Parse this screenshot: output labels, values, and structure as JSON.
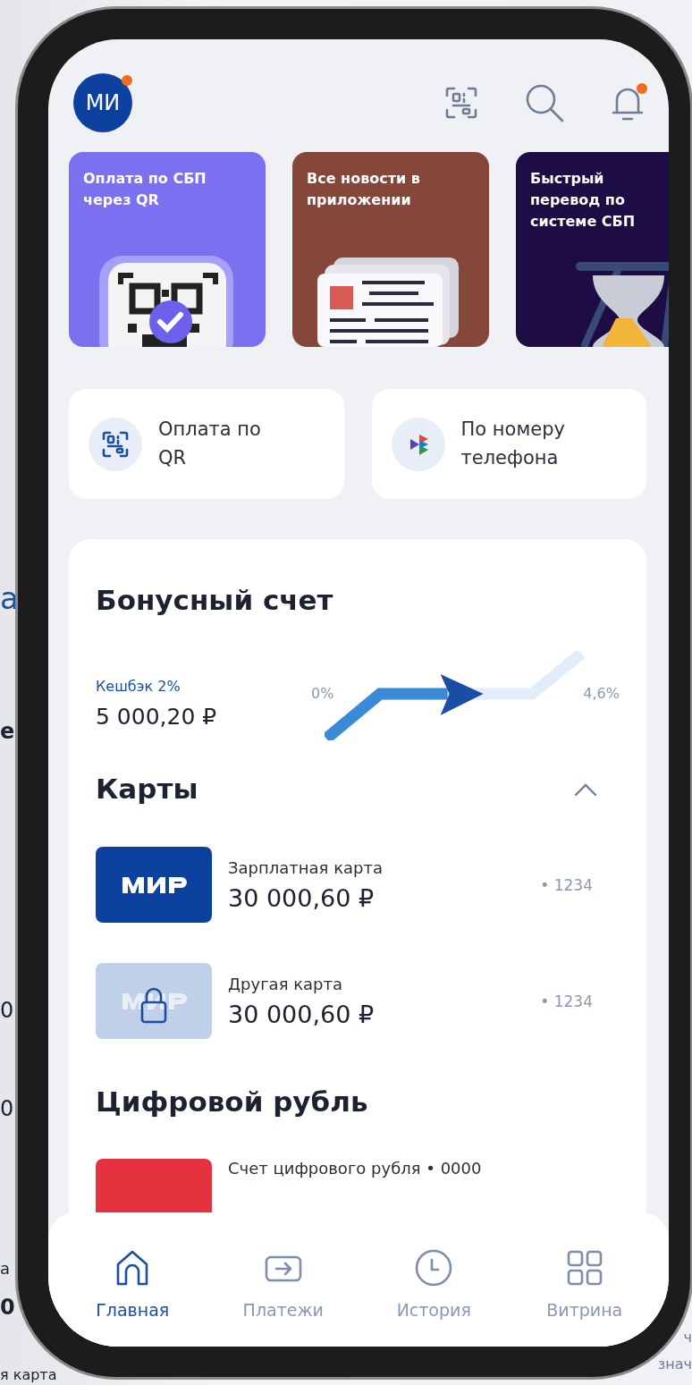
{
  "background_fragments": [
    "а",
    "е",
    "0",
    "0",
    "а",
    "0",
    "я карта",
    "ч",
    "знач"
  ],
  "header": {
    "avatar": {
      "initials": "МИ",
      "badge": true
    },
    "bell": {
      "notification": true
    }
  },
  "banners": [
    {
      "title": "Оплата по СБП через QR",
      "kind": "qr",
      "color": "#7b71f0"
    },
    {
      "title": "Все новости в приложении",
      "kind": "newspaper",
      "color": "#85473a"
    },
    {
      "title": "Быстрый перевод по системе СБП",
      "kind": "hourglass",
      "color": "#1e0c45"
    }
  ],
  "quick_actions": [
    {
      "label": "Оплата по QR",
      "kind": "qr"
    },
    {
      "label": "По номеру телефона",
      "kind": "sbp"
    }
  ],
  "bonus": {
    "title": "Бонусный счет",
    "cashback_label": "Кешбэк 2%",
    "amount": "5 000,20 ₽",
    "start_label": "0%",
    "end_label": "4,6%",
    "level": 0.68
  },
  "cards_section": {
    "title": "Карты",
    "expanded": true,
    "cards": [
      {
        "name": "Зарплатная карта",
        "amount": "30 000,60 ₽",
        "number": "• 1234",
        "locked": false
      },
      {
        "name": "Другая карта",
        "amount": "30 000,60 ₽",
        "number": "• 1234",
        "locked": true
      }
    ]
  },
  "digital_ruble": {
    "title": "Цифровой рубль",
    "account": "Счет цифрового рубля • 0000"
  },
  "tabs": [
    {
      "label": "Главная",
      "kind": "home",
      "selected": true
    },
    {
      "label": "Платежи",
      "kind": "payments",
      "selected": false
    },
    {
      "label": "История",
      "kind": "history",
      "selected": false
    },
    {
      "label": "Витрина",
      "kind": "showcase",
      "selected": false
    }
  ]
}
